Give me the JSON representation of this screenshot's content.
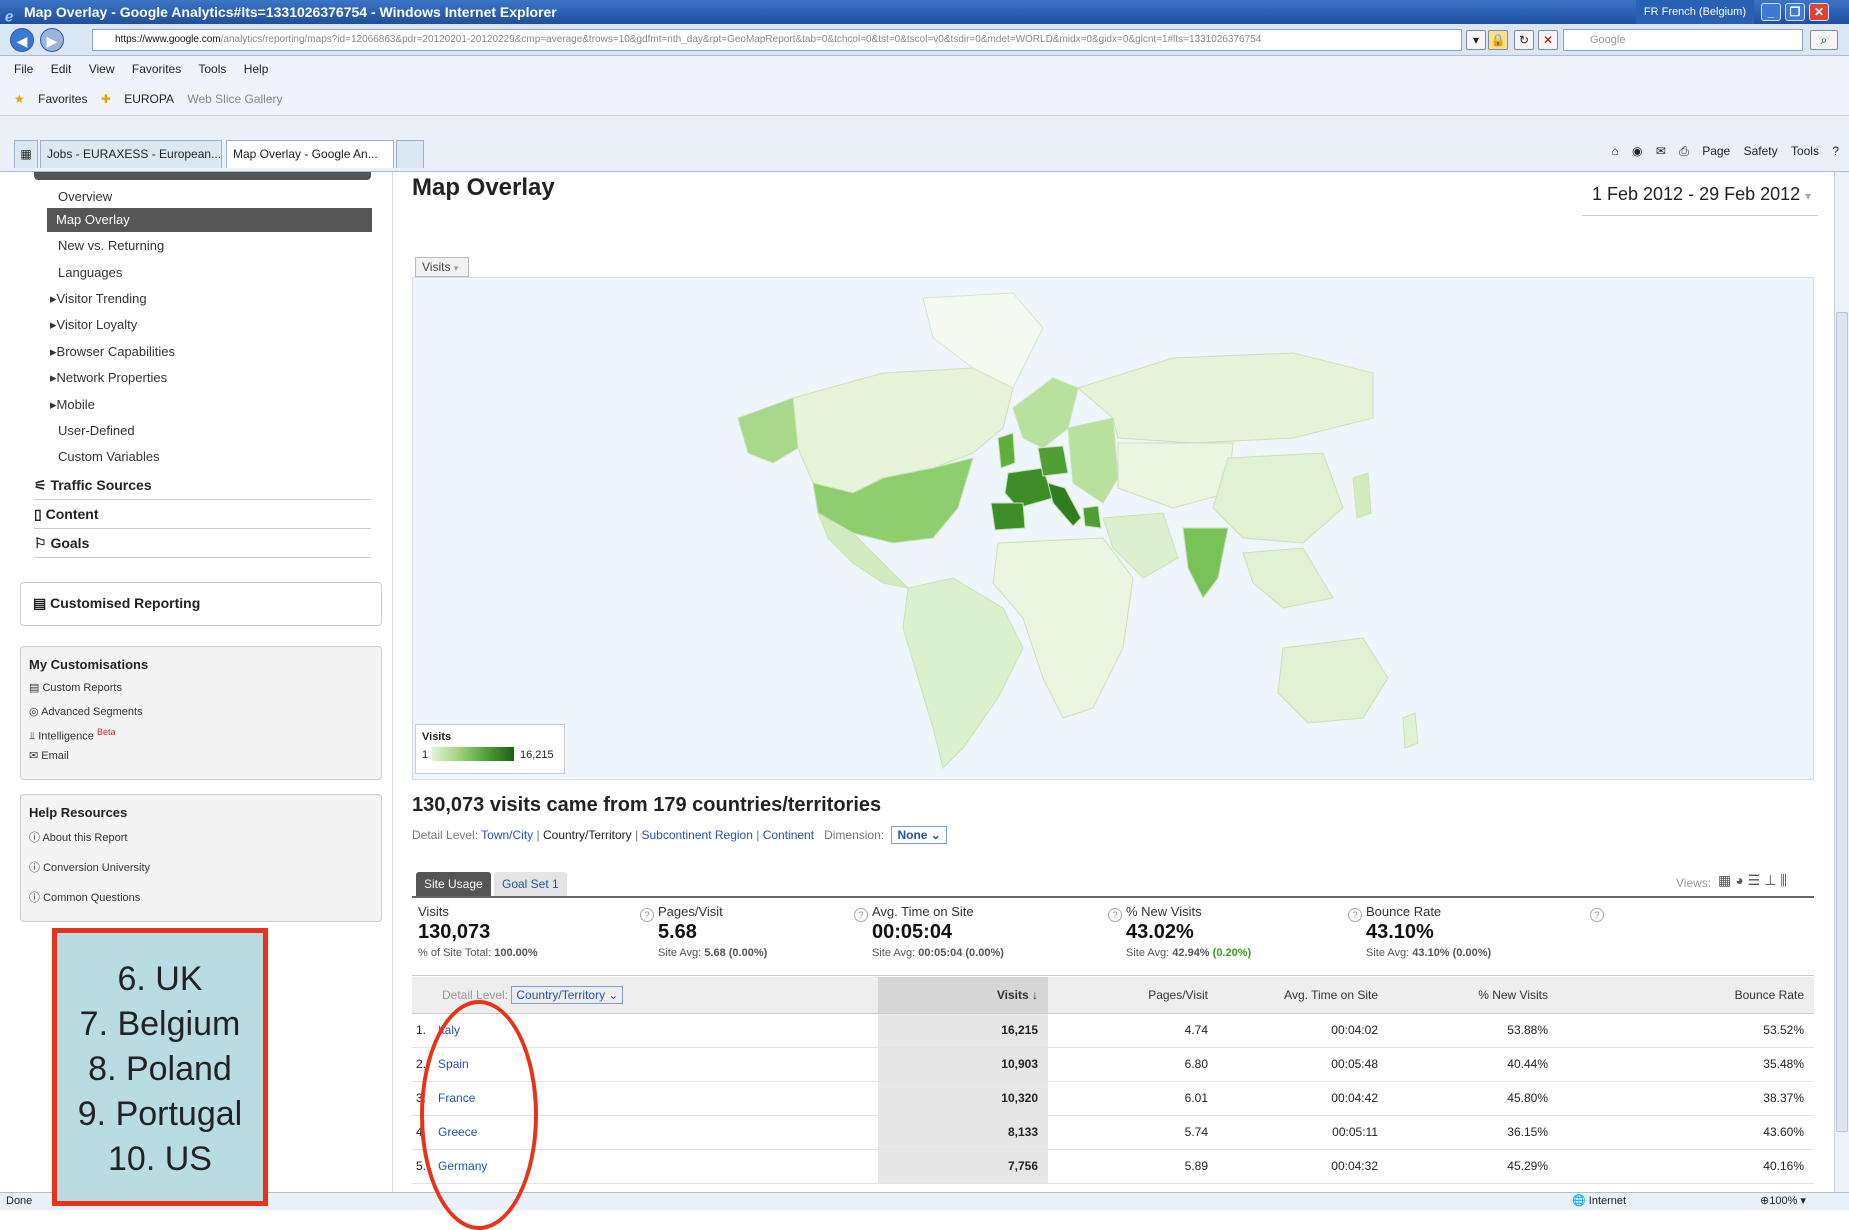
{
  "window": {
    "title": "Map Overlay - Google Analytics#lts=1331026376754 - Windows Internet Explorer",
    "language": "FR French (Belgium)"
  },
  "address": {
    "url_host": "https://www.google.com",
    "url_path": "/analytics/reporting/maps?id=12066863&pdr=20120201-20120229&cmp=average&trows=10&gdfmt=nth_day&rpt=GeoMapReport&tab=0&tchcol=0&tst=0&tscol=v0&tsdir=0&mdet=WORLD&midx=0&gidx=0&glcnt=1#lts=1331026376754",
    "search_placeholder": "Google"
  },
  "menu": [
    "File",
    "Edit",
    "View",
    "Favorites",
    "Tools",
    "Help"
  ],
  "favorites": {
    "label": "Favorites",
    "items": [
      "EUROPA",
      "Web Slice Gallery"
    ]
  },
  "tabs": [
    {
      "label": "Jobs - EURAXESS - European..."
    },
    {
      "label": "Map Overlay - Google An..."
    }
  ],
  "commands": [
    "Page",
    "Safety",
    "Tools"
  ],
  "sidebar": {
    "visitors_items": [
      "Overview",
      "Map Overlay",
      "New vs. Returning",
      "Languages",
      "Visitor Trending",
      "Visitor Loyalty",
      "Browser Capabilities",
      "Network Properties",
      "Mobile",
      "User-Defined",
      "Custom Variables"
    ],
    "sections": [
      "Traffic Sources",
      "Content",
      "Goals"
    ],
    "custom_reporting": "Customised Reporting",
    "my_custom": {
      "title": "My Customisations",
      "items": [
        "Custom Reports",
        "Advanced Segments",
        "Intelligence",
        "Email"
      ],
      "beta": "Beta"
    },
    "help": {
      "title": "Help Resources",
      "items": [
        "About this Report",
        "Conversion University",
        "Common Questions"
      ]
    }
  },
  "main": {
    "title": "Map Overlay",
    "date_range": "1 Feb 2012 - 29 Feb 2012",
    "metric_drop": "Visits",
    "legend": {
      "label": "Visits",
      "min": "1",
      "max": "16,215"
    },
    "summary": "130,073 visits came from 179 countries/territories",
    "detail": {
      "label": "Detail Level:",
      "levels": [
        "Town/City",
        "Country/Territory",
        "Subcontinent Region",
        "Continent"
      ],
      "dimension_label": "Dimension:",
      "dimension_value": "None"
    },
    "subtabs": [
      "Site Usage",
      "Goal Set 1"
    ],
    "views_label": "Views:",
    "metrics": [
      {
        "label": "Visits",
        "value": "130,073",
        "sub": "% of Site Total:",
        "sub_value": "100.00%"
      },
      {
        "label": "Pages/Visit",
        "value": "5.68",
        "sub": "Site Avg:",
        "sub_value": "5.68 (0.00%)"
      },
      {
        "label": "Avg. Time on Site",
        "value": "00:05:04",
        "sub": "Site Avg:",
        "sub_value": "00:05:04 (0.00%)"
      },
      {
        "label": "% New Visits",
        "value": "43.02%",
        "sub": "Site Avg:",
        "sub_value": "42.94%",
        "sub_extra": "(0.20%)"
      },
      {
        "label": "Bounce Rate",
        "value": "43.10%",
        "sub": "Site Avg:",
        "sub_value": "43.10% (0.00%)"
      }
    ],
    "table": {
      "detail_label": "Detail Level:",
      "detail_value": "Country/Territory",
      "columns": [
        "Visits ↓",
        "Pages/Visit",
        "Avg. Time on Site",
        "% New Visits",
        "Bounce Rate"
      ],
      "rows": [
        {
          "rank": "1.",
          "name": "Italy",
          "visits": "16,215",
          "pages": "4.74",
          "time": "00:04:02",
          "new": "53.88%",
          "bounce": "53.52%"
        },
        {
          "rank": "2.",
          "name": "Spain",
          "visits": "10,903",
          "pages": "6.80",
          "time": "00:05:48",
          "new": "40.44%",
          "bounce": "35.48%"
        },
        {
          "rank": "3.",
          "name": "France",
          "visits": "10,320",
          "pages": "6.01",
          "time": "00:04:42",
          "new": "45.80%",
          "bounce": "38.37%"
        },
        {
          "rank": "4.",
          "name": "Greece",
          "visits": "8,133",
          "pages": "5.74",
          "time": "00:05:11",
          "new": "36.15%",
          "bounce": "43.60%"
        },
        {
          "rank": "5.",
          "name": "Germany",
          "visits": "7,756",
          "pages": "5.89",
          "time": "00:04:32",
          "new": "45.29%",
          "bounce": "40.16%"
        }
      ]
    }
  },
  "callout": [
    "6. UK",
    "7. Belgium",
    "8. Poland",
    "9. Portugal",
    "10. US"
  ],
  "status": {
    "left": "Done",
    "zone": "Internet",
    "zoom": "100%"
  },
  "colors": {
    "highlight": "#e8331a",
    "callout_bg": "#b9dbe2",
    "map_dark": "#2f7d1f",
    "map_light": "#e2f3d6"
  }
}
